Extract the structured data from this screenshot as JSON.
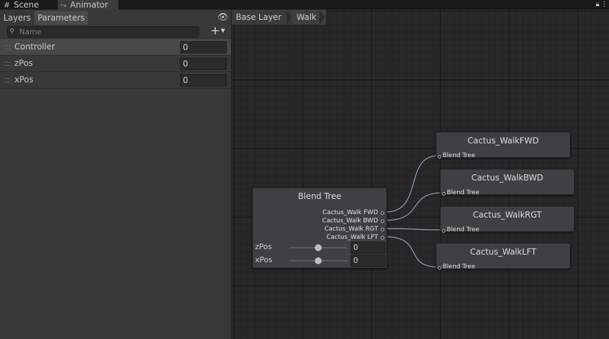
{
  "tabs": [
    {
      "label": "Scene",
      "icon": "grid-icon"
    },
    {
      "label": "Animator",
      "icon": "animator-icon"
    }
  ],
  "left_panel": {
    "subtabs": [
      "Layers",
      "Parameters"
    ],
    "search_placeholder": "Name",
    "parameters": [
      {
        "name": "Controller",
        "value": "0"
      },
      {
        "name": "zPos",
        "value": "0"
      },
      {
        "name": "xPos",
        "value": "0"
      }
    ]
  },
  "breadcrumb": [
    "Base Layer",
    "Walk"
  ],
  "blend_tree": {
    "title": "Blend Tree",
    "outputs": [
      "Cactus_Walk FWD",
      "Cactus_Walk BWD",
      "Cactus_Walk RGT",
      "Cactus_Walk LFT"
    ],
    "params": [
      {
        "name": "zPos",
        "value": "0"
      },
      {
        "name": "xPos",
        "value": "0"
      }
    ]
  },
  "motion_nodes": [
    {
      "title": "Cactus_WalkFWD",
      "label": "Blend Tree"
    },
    {
      "title": "Cactus_WalkBWD",
      "label": "Blend Tree"
    },
    {
      "title": "Cactus_WalkRGT",
      "label": "Blend Tree"
    },
    {
      "title": "Cactus_WalkLFT",
      "label": "Blend Tree"
    }
  ],
  "colors": {
    "wire": "#8fa6bf",
    "graph_bg": "#282828",
    "node_bg": "#3f4043"
  }
}
